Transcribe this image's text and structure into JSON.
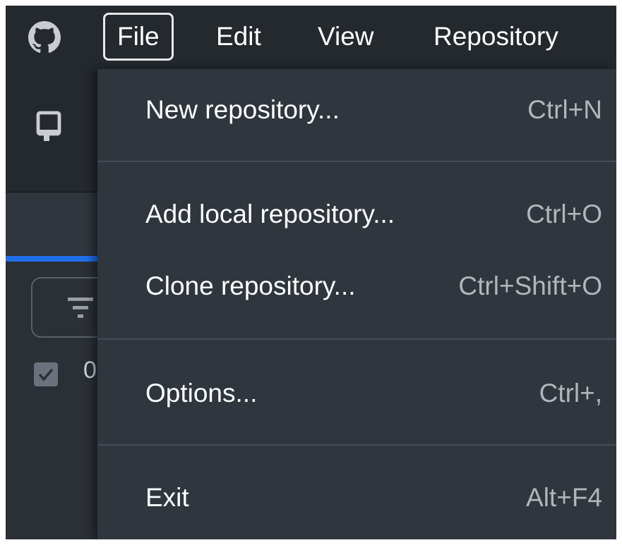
{
  "menubar": {
    "items": [
      {
        "label": "File",
        "active": true
      },
      {
        "label": "Edit",
        "active": false
      },
      {
        "label": "View",
        "active": false
      },
      {
        "label": "Repository",
        "active": false
      }
    ]
  },
  "background": {
    "digit": "0"
  },
  "file_menu": {
    "items": [
      {
        "label": "New repository...",
        "shortcut": "Ctrl+N"
      },
      {
        "label": "Add local repository...",
        "shortcut": "Ctrl+O"
      },
      {
        "label": "Clone repository...",
        "shortcut": "Ctrl+Shift+O"
      },
      {
        "label": "Options...",
        "shortcut": "Ctrl+,"
      },
      {
        "label": "Exit",
        "shortcut": "Alt+F4"
      }
    ]
  },
  "icons": {
    "logo": "github-logo-icon",
    "repo": "repository-icon",
    "filter": "filter-icon",
    "checkbox": "checkbox-icon"
  },
  "colors": {
    "menubar_bg": "#24292e",
    "menu_bg": "#2f363d",
    "accent": "#1f6feb",
    "text": "#ffffff",
    "shortcut_text": "#b1b6bb"
  }
}
